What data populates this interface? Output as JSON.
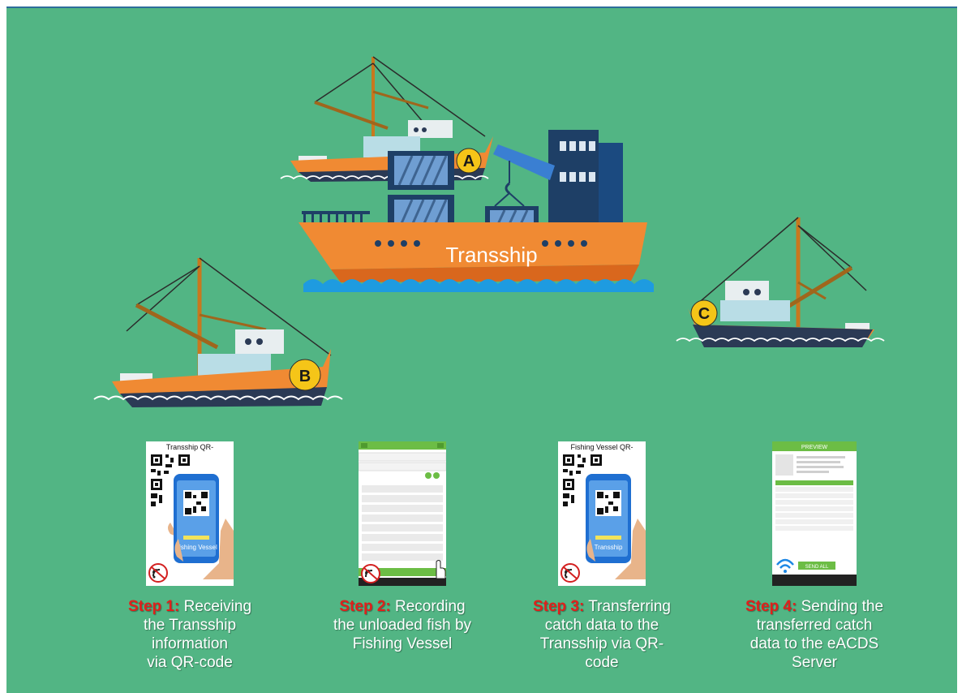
{
  "ships": {
    "transship_label": "Transship",
    "badge_a": "A",
    "badge_b": "B",
    "badge_c": "C"
  },
  "steps": [
    {
      "num": "Step 1",
      "sep": ":",
      "lines": [
        "Receiving",
        "the Transship",
        "information",
        "via QR-code"
      ],
      "image_title": "Transship QR-",
      "phone_label": "Fishing Vessel"
    },
    {
      "num": "Step 2",
      "sep": ":",
      "lines": [
        "Recording",
        "the unloaded fish by",
        "Fishing Vessel"
      ]
    },
    {
      "num": "Step 3",
      "sep": ":",
      "lines": [
        "Transferring",
        "catch data to the",
        "Transship via QR-",
        "code"
      ],
      "image_title": "Fishing Vessel QR-",
      "phone_label": "Transship"
    },
    {
      "num": "Step 4",
      "sep": ":",
      "lines": [
        "Sending the",
        "transferred catch",
        "data to the eACDS",
        "Server"
      ],
      "screen_title": "PREVIEW",
      "button_label": "SEND ALL"
    }
  ],
  "colors": {
    "background": "#52b584",
    "hull_orange": "#f08a33",
    "hull_navy": "#2b3a55",
    "container_navy": "#1e3f66",
    "water_blue": "#1e9be0",
    "badge_yellow": "#f5c518",
    "step_red": "#e0201b",
    "app_green": "#6cbd45"
  }
}
